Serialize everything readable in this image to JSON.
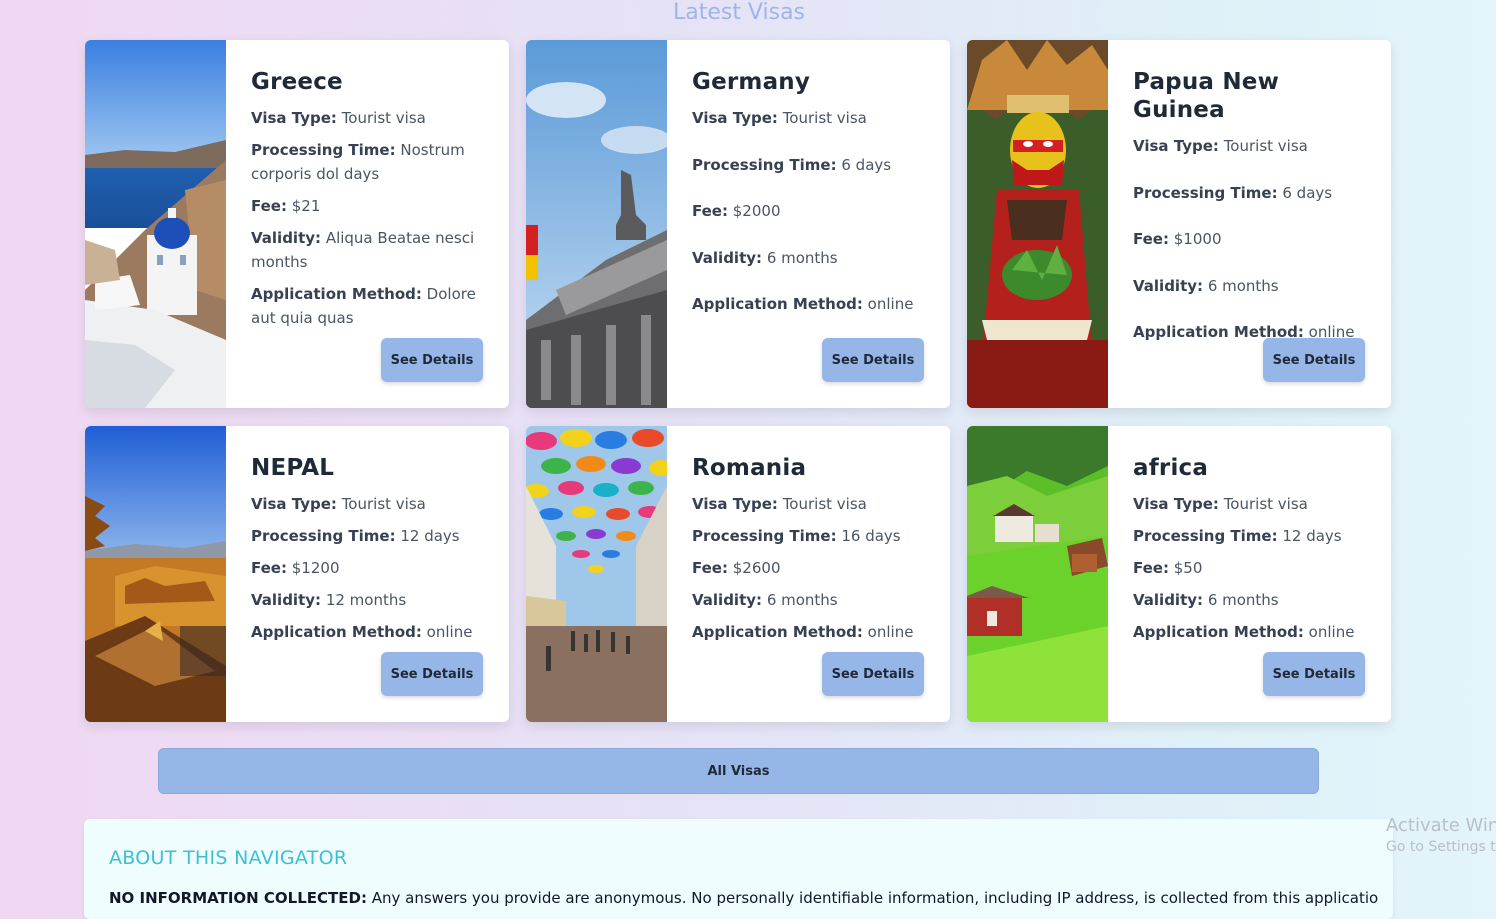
{
  "section_title": "Latest Visas",
  "labels": {
    "visa_type": "Visa Type:",
    "processing_time": "Processing Time:",
    "fee": "Fee:",
    "validity": "Validity:",
    "application_method": "Application Method:",
    "see_details": "See Details"
  },
  "visas": [
    {
      "country": "Greece",
      "visa_type": "Tourist visa",
      "processing_time": "Nostrum corporis dol days",
      "fee": "$21",
      "validity": "Aliqua Beatae nesci months",
      "application_method": "Dolore aut quia quas"
    },
    {
      "country": "Germany",
      "visa_type": "Tourist visa",
      "processing_time": "6 days",
      "fee": "$2000",
      "validity": "6 months",
      "application_method": "online"
    },
    {
      "country": "Papua New Guinea",
      "visa_type": "Tourist visa",
      "processing_time": "6 days",
      "fee": "$1000",
      "validity": "6 months",
      "application_method": "online"
    },
    {
      "country": "NEPAL",
      "visa_type": "Tourist visa",
      "processing_time": "12 days",
      "fee": "$1200",
      "validity": "12 months",
      "application_method": "online"
    },
    {
      "country": "Romania",
      "visa_type": "Tourist visa",
      "processing_time": "16 days",
      "fee": "$2600",
      "validity": "6 months",
      "application_method": "online"
    },
    {
      "country": "africa",
      "visa_type": "Tourist visa",
      "processing_time": "12 days",
      "fee": "$50",
      "validity": "6 months",
      "application_method": "online"
    }
  ],
  "all_visas_label": "All Visas",
  "about": {
    "title": "ABOUT THIS NAVIGATOR",
    "lead": "NO INFORMATION COLLECTED:",
    "text": " Any answers you provide are anonymous. No personally identifiable information, including IP address, is collected from this application, and the"
  },
  "watermark": {
    "line1": "Activate Win",
    "line2": "Go to Settings to"
  }
}
